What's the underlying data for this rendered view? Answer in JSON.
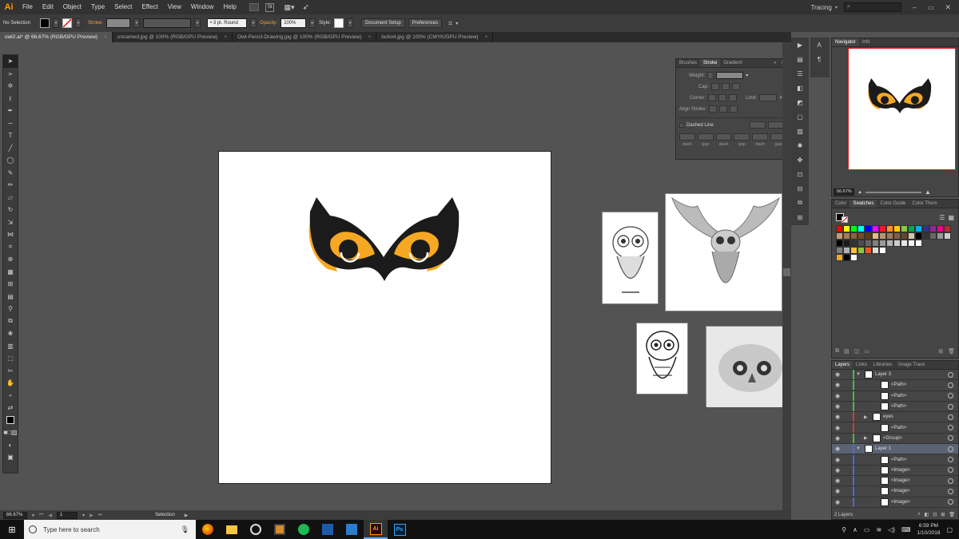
{
  "menubar": {
    "app_logo": "Ai",
    "items": [
      "File",
      "Edit",
      "Object",
      "Type",
      "Select",
      "Effect",
      "View",
      "Window",
      "Help"
    ],
    "mode_badge": "St",
    "workspace": "Tracing",
    "search_placeholder": ""
  },
  "controlbar": {
    "selection": "No Selection",
    "stroke_label": "Stroke:",
    "brush": "3 pt. Round",
    "opacity_label": "Opacity:",
    "opacity": "100%",
    "style_label": "Style:",
    "document_setup": "Document Setup",
    "preferences": "Preferences"
  },
  "tabs": [
    {
      "label": "owl2.ai* @ 66.67% (RGB/GPU Preview)",
      "active": true
    },
    {
      "label": "unnamed.jpg @ 100% (RGB/GPU Preview)",
      "active": false
    },
    {
      "label": "Owl-Pencil-Drawing.jpg @ 100% (RGB/GPU Preview)",
      "active": false
    },
    {
      "label": "buho4.jpg @ 100% (CMYK/GPU Preview)",
      "active": false
    }
  ],
  "tab_close": "×",
  "stroke_panel": {
    "tabs": [
      "Brushes",
      "Stroke",
      "Gradient"
    ],
    "weight_label": "Weight:",
    "cap_label": "Cap:",
    "corner_label": "Corner:",
    "limit_label": "Limit:",
    "align_label": "Align Stroke:",
    "dashed_label": "Dashed Line",
    "dash_labels": [
      "dash",
      "gap",
      "dash",
      "gap",
      "dash",
      "gap"
    ]
  },
  "navigator": {
    "tabs": [
      "Navigator",
      "Info"
    ],
    "zoom": "66.67%"
  },
  "swatches_panel": {
    "tabs": [
      "Color",
      "Swatches",
      "Color Guide",
      "Color Them"
    ],
    "colors": [
      [
        "#ff0000",
        "#ffff00",
        "#00ff00",
        "#00ffff",
        "#0000ff",
        "#ff00ff",
        "#ed1c24",
        "#f7941d",
        "#ffcd00",
        "#8dc63f",
        "#00a651",
        "#00aeef",
        "#2e3192",
        "#92278f",
        "#ec008c",
        "#c1272d"
      ],
      [
        "#c69c6d",
        "#a67c52",
        "#8c6239",
        "#754c24",
        "#603913",
        "#e6b88a",
        "#b7956f",
        "#9e7b5a",
        "#7f5f45",
        "#62462f",
        "#d4c5a9",
        "#000000",
        "#333333",
        "#666666",
        "#999999",
        "#cccccc"
      ],
      [
        "#000000",
        "#1a1a1a",
        "#333333",
        "#4d4d4d",
        "#666666",
        "#808080",
        "#999999",
        "#b3b3b3",
        "#cccccc",
        "#e6e6e6",
        "#f2f2f2",
        "#ffffff"
      ],
      [
        "#7d7d7d",
        "#b0b0b0",
        "#ffbe3c",
        "#8dc63f",
        "#ec5a24",
        "#dddddd",
        "#ffffff"
      ],
      [
        "#f7a823",
        "#000000",
        "#ffffff"
      ]
    ]
  },
  "layers_panel": {
    "tabs": [
      "Layers",
      "Links",
      "Libraries",
      "Image Trace"
    ],
    "rows": [
      {
        "name": "Layer 3",
        "indent": 0,
        "expanded": true,
        "bar": "#4cb84c"
      },
      {
        "name": "<Path>",
        "indent": 2,
        "bar": "#4cb84c"
      },
      {
        "name": "<Path>",
        "indent": 2,
        "bar": "#4cb84c"
      },
      {
        "name": "<Path>",
        "indent": 2,
        "bar": "#4cb84c"
      },
      {
        "name": "eyes",
        "indent": 1,
        "expanded": false,
        "bar": "#d23c3c"
      },
      {
        "name": "<Path>",
        "indent": 2,
        "bar": "#d23c3c"
      },
      {
        "name": "<Group>",
        "indent": 1,
        "expanded": false,
        "bar": "#4cb84c"
      },
      {
        "name": "Layer 1",
        "indent": 0,
        "expanded": true,
        "bar": "#4a6ad2",
        "selected": true
      },
      {
        "name": "<Path>",
        "indent": 2,
        "bar": "#4a6ad2"
      },
      {
        "name": "<Image>",
        "indent": 2,
        "bar": "#4a6ad2"
      },
      {
        "name": "<Image>",
        "indent": 2,
        "bar": "#4a6ad2"
      },
      {
        "name": "<Image>",
        "indent": 2,
        "bar": "#4a6ad2"
      },
      {
        "name": "<Image>",
        "indent": 2,
        "bar": "#4a6ad2"
      }
    ],
    "footer": "2 Layers"
  },
  "statusbar": {
    "zoom": "66.67%",
    "page": "1",
    "tool": "Selection"
  },
  "taskbar": {
    "search_placeholder": "Type here to search",
    "time": "6:59 PM",
    "date": "1/10/2018",
    "apps": [
      {
        "name": "Ai",
        "color": "#ff9a00",
        "bg": "#330000"
      },
      {
        "name": "Ps",
        "color": "#31a8ff",
        "bg": "#001e36"
      }
    ]
  },
  "colors": {
    "owl_orange": "#f7a823",
    "owl_dark": "#1b1b1b",
    "ai_orange": "#ff9a00"
  }
}
